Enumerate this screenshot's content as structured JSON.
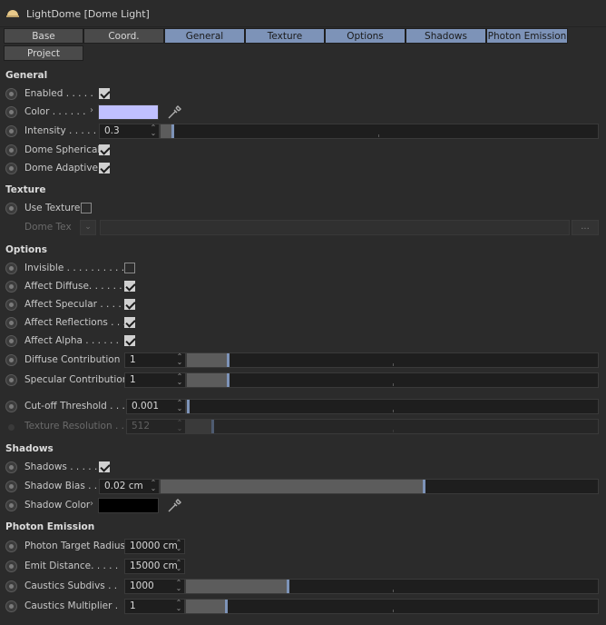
{
  "window": {
    "title": "LightDome [Dome Light]"
  },
  "tabs": [
    {
      "label": "Base",
      "active": false
    },
    {
      "label": "Coord.",
      "active": false
    },
    {
      "label": "General",
      "active": true
    },
    {
      "label": "Texture",
      "active": true
    },
    {
      "label": "Options",
      "active": true
    },
    {
      "label": "Shadows",
      "active": true
    },
    {
      "label": "Photon Emission",
      "active": true
    },
    {
      "label": "Project",
      "active": false
    }
  ],
  "general": {
    "title": "General",
    "enabled": {
      "label": "Enabled . . . . .",
      "checked": true
    },
    "color": {
      "label": "Color . . . . . .",
      "value": "#c0c0ff"
    },
    "intensity": {
      "label": "Intensity . . . . .",
      "value": "0.3",
      "slider_fraction": 0.03
    },
    "dome_spherical": {
      "label": "Dome Spherical",
      "checked": true
    },
    "dome_adaptive": {
      "label": "Dome Adaptive",
      "checked": true
    }
  },
  "texture": {
    "title": "Texture",
    "use_texture": {
      "label": "Use Texture",
      "checked": false
    },
    "dome_tex": {
      "label": "Dome Tex",
      "button": "..."
    }
  },
  "options": {
    "title": "Options",
    "invisible": {
      "label": "Invisible . . . . . . . . . .",
      "checked": false
    },
    "affect_diffuse": {
      "label": "Affect Diffuse. . . . . .",
      "checked": true
    },
    "affect_specular": {
      "label": "Affect Specular . . . .",
      "checked": true
    },
    "affect_reflections": {
      "label": "Affect Reflections . . .",
      "checked": true
    },
    "affect_alpha": {
      "label": "Affect Alpha . . . . . .",
      "checked": true
    },
    "diffuse_contribution": {
      "label": "Diffuse Contribution",
      "value": "1",
      "slider_fraction": 0.1
    },
    "specular_contribution": {
      "label": "Specular Contribution",
      "value": "1",
      "slider_fraction": 0.1
    },
    "cutoff_threshold": {
      "label": "Cut-off Threshold . . .",
      "value": "0.001",
      "slider_fraction": 0.0
    },
    "texture_resolution": {
      "label": "Texture Resolution . .",
      "value": "512",
      "slider_fraction": 0.06
    }
  },
  "shadows": {
    "title": "Shadows",
    "shadows": {
      "label": "Shadows . . . . .",
      "checked": true
    },
    "shadow_bias": {
      "label": "Shadow Bias . .",
      "value": "0.02 cm",
      "slider_fraction": 0.6
    },
    "shadow_color": {
      "label": "Shadow Color",
      "value": "#000000"
    }
  },
  "photon_emission": {
    "title": "Photon Emission",
    "photon_target_radius": {
      "label": "Photon Target Radius",
      "value": "10000 cm"
    },
    "emit_distance": {
      "label": "Emit Distance. . . . .",
      "value": "15000 cm"
    },
    "caustics_subdivs": {
      "label": "Caustics Subdivs . .",
      "value": "1000",
      "slider_fraction": 0.24
    },
    "caustics_multiplier": {
      "label": "Caustics Multiplier .",
      "value": "1",
      "slider_fraction": 0.1
    }
  },
  "icons": {
    "window": "light-dome-icon",
    "eyedropper": "eyedropper-icon",
    "expand": "chevron-right-icon",
    "spinner": "spinner-arrows-icon"
  },
  "colors": {
    "background": "#2b2b2b",
    "accent": "#7d93b8",
    "field": "#1e1e1e"
  }
}
